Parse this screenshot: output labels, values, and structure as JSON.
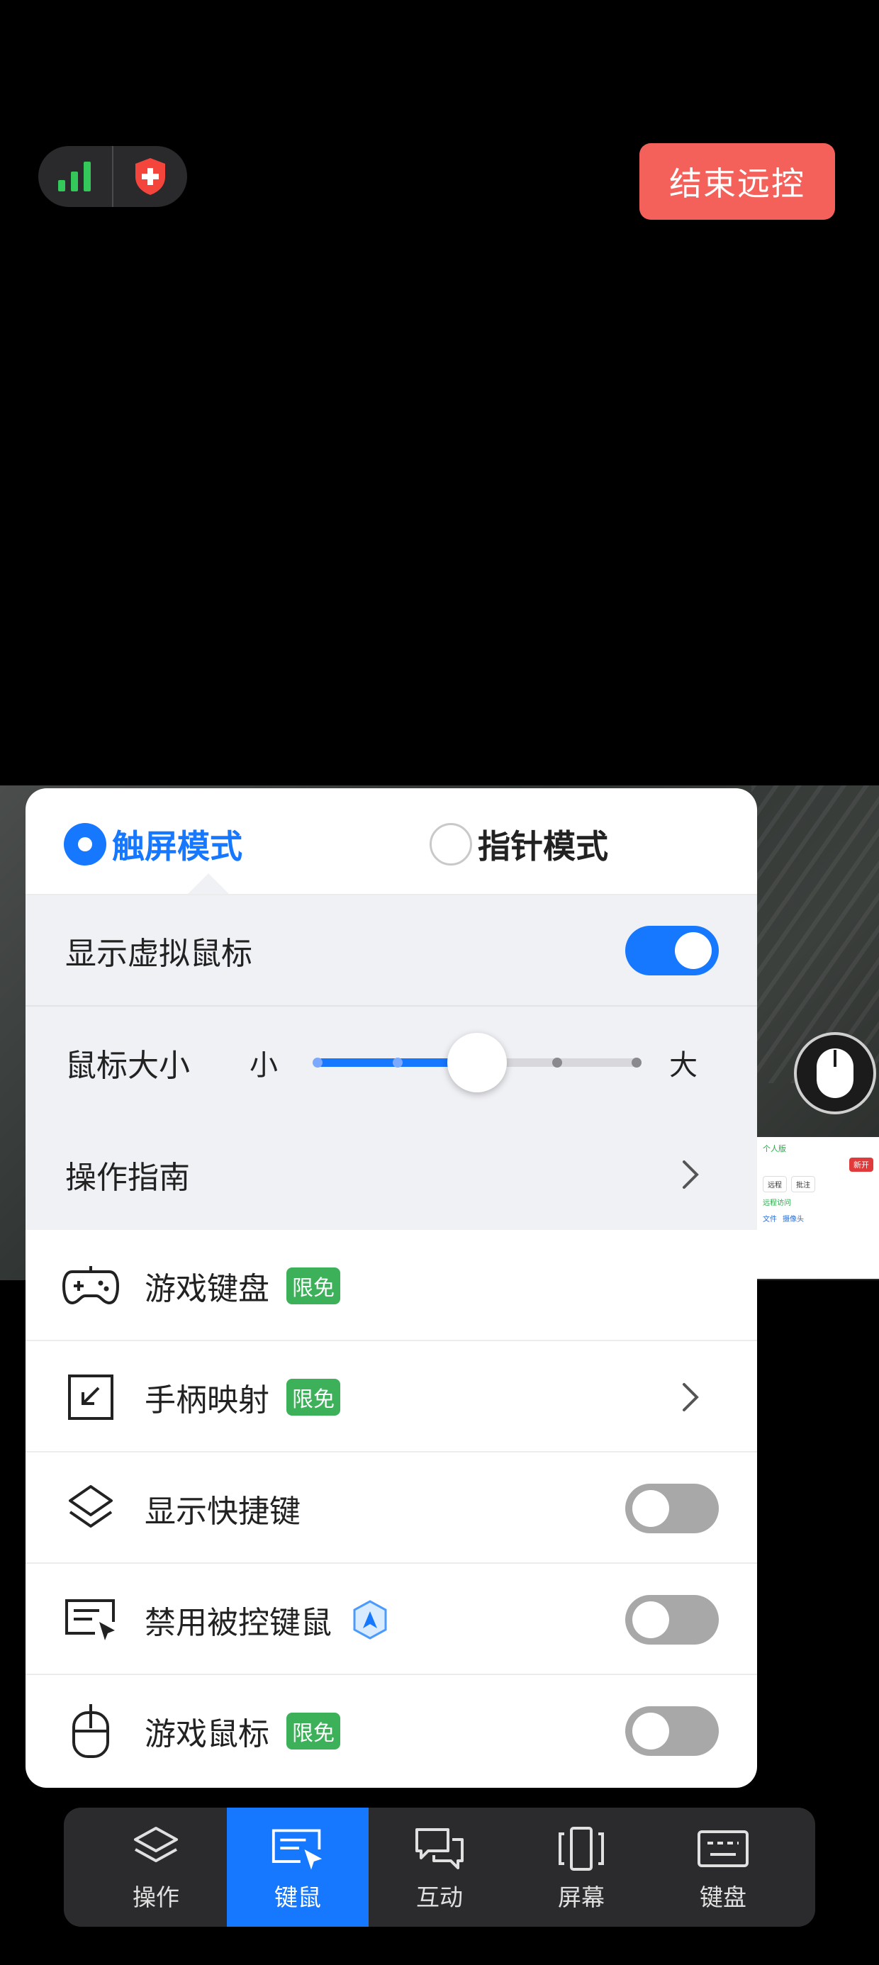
{
  "header": {
    "end_button": "结束远控",
    "signal_icon": "signal-bars-icon",
    "shield_icon": "security-shield-icon"
  },
  "panel": {
    "modes": [
      {
        "label": "触屏模式",
        "selected": true
      },
      {
        "label": "指针模式",
        "selected": false
      }
    ],
    "show_virtual_mouse": {
      "label": "显示虚拟鼠标",
      "on": true
    },
    "mouse_size": {
      "label": "鼠标大小",
      "min_label": "小",
      "max_label": "大",
      "steps": 5,
      "value_step": 3
    },
    "guide": {
      "label": "操作指南"
    },
    "items": [
      {
        "label": "游戏键盘",
        "icon": "gamepad-icon",
        "badge": "限免"
      },
      {
        "label": "手柄映射",
        "icon": "controller-mapping-icon",
        "badge": "限免"
      },
      {
        "label": "显示快捷键",
        "icon": "shortcut-icon",
        "toggle": false
      },
      {
        "label": "禁用被控键鼠",
        "icon": "keyboard-cursor-icon",
        "badge_icon": "premium-shield-icon",
        "toggle": false
      },
      {
        "label": "游戏鼠标",
        "icon": "mouse-icon",
        "badge": "限免",
        "toggle": false
      }
    ]
  },
  "toolbar": {
    "items": [
      {
        "label": "操作",
        "icon": "layers-icon"
      },
      {
        "label": "键鼠",
        "icon": "keyboard-mouse-icon",
        "active": true
      },
      {
        "label": "互动",
        "icon": "chat-bubbles-icon"
      },
      {
        "label": "屏幕",
        "icon": "screen-icon"
      },
      {
        "label": "键盘",
        "icon": "keyboard-icon"
      }
    ]
  },
  "thumbnail": {
    "tag": "个人版",
    "action": "新开",
    "btn1": "远程",
    "btn2": "批注",
    "green_text": "远程访问",
    "small1": "文件",
    "small2": "摄像头"
  },
  "colors": {
    "accent": "#1677ff",
    "end_button": "#f4615a",
    "badge_green": "#3cb15a"
  }
}
